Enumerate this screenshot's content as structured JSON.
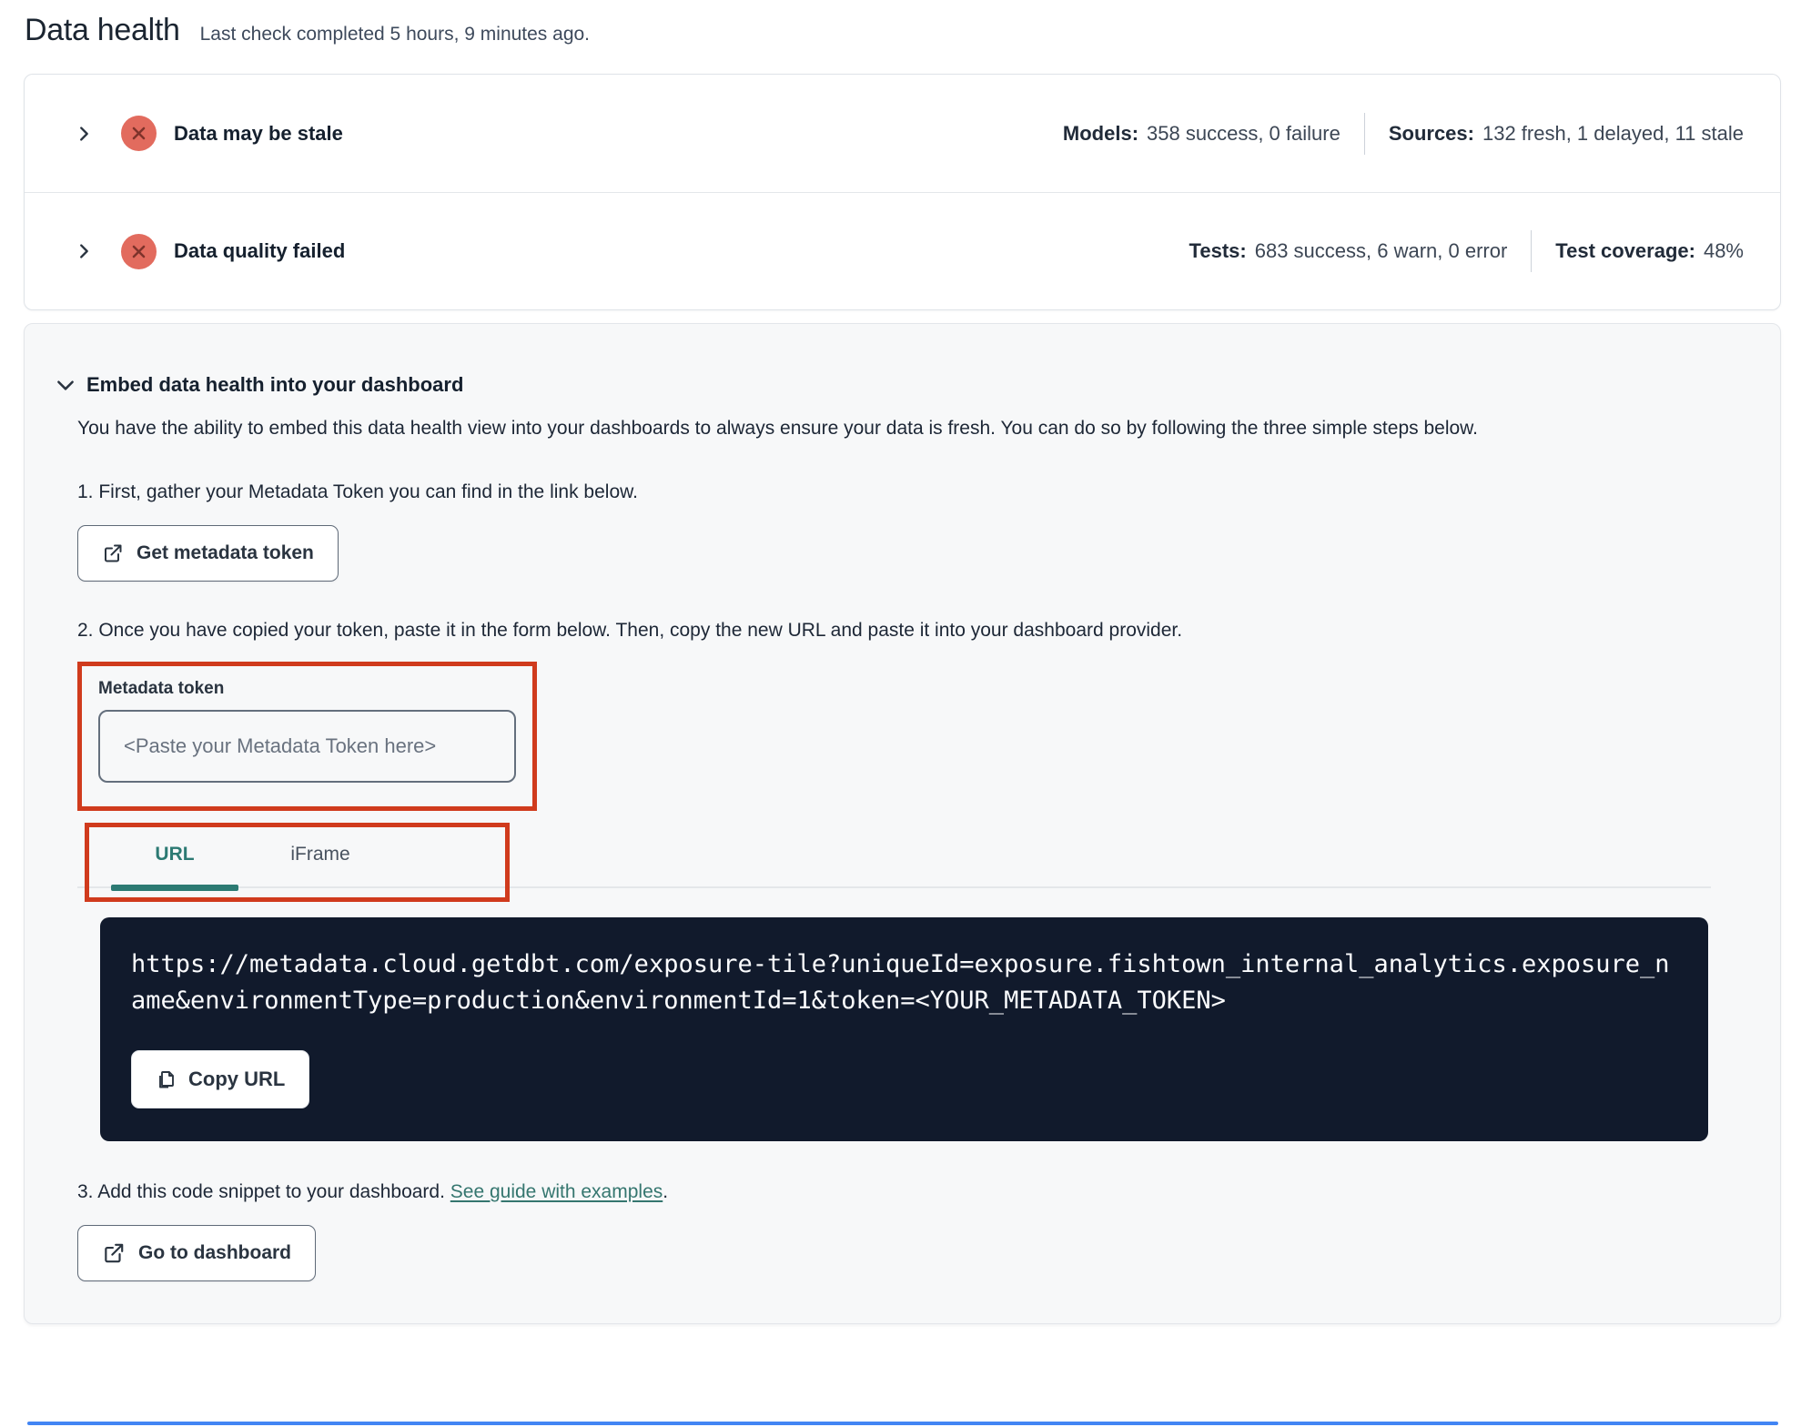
{
  "page": {
    "title": "Data health",
    "subtitle": "Last check completed 5 hours, 9 minutes ago."
  },
  "status_rows": [
    {
      "title": "Data may be stale",
      "status_icon": "error-x-icon",
      "stats": [
        {
          "label": "Models:",
          "value": "358 success, 0 failure"
        },
        {
          "label": "Sources:",
          "value": "132 fresh, 1 delayed, 11 stale"
        }
      ]
    },
    {
      "title": "Data quality failed",
      "status_icon": "error-x-icon",
      "stats": [
        {
          "label": "Tests:",
          "value": "683 success, 6 warn, 0 error"
        },
        {
          "label": "Test coverage:",
          "value": "48%"
        }
      ]
    }
  ],
  "embed": {
    "title": "Embed data health into your dashboard",
    "description": "You have the ability to embed this data health view into your dashboards to always ensure your data is fresh. You can do so by following the three simple steps below.",
    "step1": "1. First, gather your Metadata Token you can find in the link below.",
    "get_token_button": "Get metadata token",
    "step2": "2. Once you have copied your token, paste it in the form below. Then, copy the new URL and paste it into your dashboard provider.",
    "token_label": "Metadata token",
    "token_placeholder": "<Paste your Metadata Token here>",
    "tabs": [
      {
        "label": "URL",
        "active": true
      },
      {
        "label": "iFrame",
        "active": false
      }
    ],
    "code_url": "https://metadata.cloud.getdbt.com/exposure-tile?uniqueId=exposure.fishtown_internal_analytics.exposure_name&environmentType=production&environmentId=1&token=<YOUR_METADATA_TOKEN>",
    "copy_button": "Copy URL",
    "step3_prefix": "3. Add this code snippet to your dashboard. ",
    "step3_link": "See guide with examples",
    "step3_suffix": ".",
    "dashboard_button": "Go to dashboard"
  },
  "colors": {
    "accent_teal": "#2c7a73",
    "link_teal": "#35766f",
    "annotation_red": "#d03b1d",
    "error_badge_red": "#e26b5e",
    "code_background": "#111a2c",
    "panel_background": "#f7f8f9"
  }
}
